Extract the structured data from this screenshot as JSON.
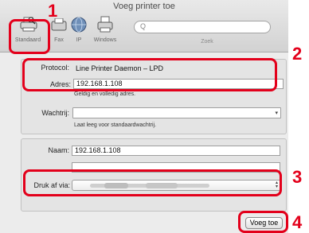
{
  "window": {
    "title": "Voeg printer toe"
  },
  "toolbar": {
    "items": [
      {
        "label": "Standaard",
        "icon": "printer-magnifier-icon"
      },
      {
        "label": "Fax",
        "icon": "fax-icon"
      },
      {
        "label": "IP",
        "icon": "globe-icon"
      },
      {
        "label": "Windows",
        "icon": "printer-icon"
      }
    ],
    "search_placeholder": "Zoek",
    "search_glyph": "Q"
  },
  "connection": {
    "protocol_label": "Protocol:",
    "protocol_value": "Line Printer Daemon – LPD",
    "address_label": "Adres:",
    "address_value": "192.168.1.108",
    "address_hint": "Geldig en volledig adres.",
    "queue_label": "Wachtrij:",
    "queue_value": "",
    "queue_hint": "Laat leeg voor standaardwachtrij."
  },
  "details": {
    "name_label": "Naam:",
    "name_value": "192.168.1.108",
    "location_value": "",
    "driver_label": "Druk af via:"
  },
  "actions": {
    "add_label": "Voeg toe"
  },
  "callouts": [
    "1",
    "2",
    "3",
    "4"
  ],
  "colors": {
    "highlight": "#e3001b"
  }
}
